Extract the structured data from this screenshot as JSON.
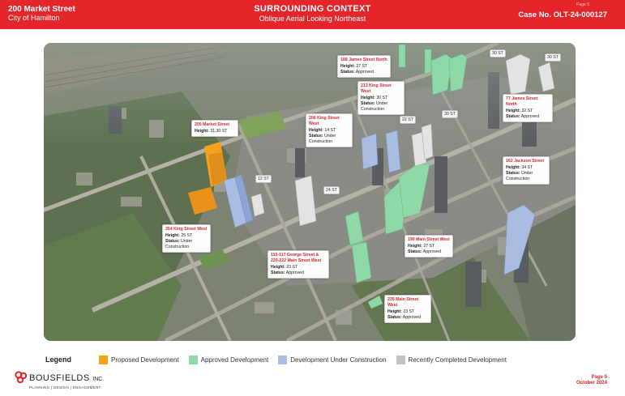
{
  "header": {
    "address": "200 Market Street",
    "city": "City of Hamilton",
    "title": "SURROUNDING CONTEXT",
    "subtitle": "Oblique Aerial Looking Northeast",
    "case_no": "Case No. OLT-24-000127",
    "stamp": "Page 5",
    "accent_color": "#e4262b"
  },
  "callouts": [
    {
      "id": "market",
      "title": "200 Market Street",
      "lines": [
        [
          "Height:",
          "31,30 ST"
        ]
      ]
    },
    {
      "id": "james-n-188",
      "title": "188 James Street North",
      "lines": [
        [
          "Height:",
          "27 ST"
        ],
        [
          "Status:",
          "Approved"
        ]
      ]
    },
    {
      "id": "king-w-213",
      "title": "213 King Street West",
      "lines": [
        [
          "Height:",
          "30 ST"
        ],
        [
          "Status:",
          "Under Construction"
        ]
      ]
    },
    {
      "id": "james-n-77",
      "title": "77 James Street North",
      "lines": [
        [
          "Height:",
          "32 ST"
        ],
        [
          "Status:",
          "Approved"
        ]
      ]
    },
    {
      "id": "king-w-206",
      "title": "206 King Street West",
      "lines": [
        [
          "Height:",
          "14 ST"
        ],
        [
          "Status:",
          "Under Construction"
        ]
      ]
    },
    {
      "id": "jackson-162",
      "title": "162 Jackson Street",
      "lines": [
        [
          "Height:",
          "34 ST"
        ],
        [
          "Status:",
          "Under Construction"
        ]
      ]
    },
    {
      "id": "king-w-354",
      "title": "354 King Street West",
      "lines": [
        [
          "Height:",
          "25 ST"
        ],
        [
          "Status:",
          "Under Construction"
        ]
      ]
    },
    {
      "id": "george",
      "title": "115-117 George Street & 220-222 Main Street West",
      "lines": [
        [
          "Height:",
          "23 ST"
        ],
        [
          "Status:",
          "Approved"
        ]
      ]
    },
    {
      "id": "main-w-190",
      "title": "190 Main Street West",
      "lines": [
        [
          "Height:",
          "27 ST"
        ],
        [
          "Status:",
          "Approved"
        ]
      ]
    },
    {
      "id": "main-w-235",
      "title": "235 Main Street West",
      "lines": [
        [
          "Height:",
          "23 ST"
        ],
        [
          "Status:",
          "Approved"
        ]
      ]
    }
  ],
  "tags": [
    "30 ST",
    "30 ST",
    "30 ST",
    "22 ST",
    "12 ST",
    "24 ST"
  ],
  "legend": {
    "title": "Legend",
    "items": [
      {
        "label": "Proposed Development",
        "color": "#f5a11c"
      },
      {
        "label": "Approved Development",
        "color": "#8fd9a8"
      },
      {
        "label": "Development Under Construction",
        "color": "#a9bde3"
      },
      {
        "label": "Recently Completed Development",
        "color": "#c2c2c2"
      }
    ]
  },
  "logo": {
    "name": "BOUSFIELDS",
    "suffix": "INC.",
    "tagline": "PLANNING | DESIGN | ENGAGEMENT"
  },
  "footer": {
    "page": "Page 5",
    "date": "October 2024"
  }
}
